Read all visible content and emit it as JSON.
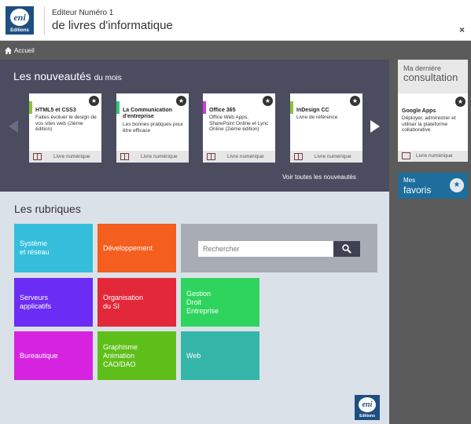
{
  "header": {
    "logo_text": "eni",
    "logo_sub": "Editions",
    "subtitle": "Editeur Numéro 1",
    "title": "de livres d'informatique",
    "close_label": "×"
  },
  "breadcrumb": {
    "home_label": "Accueil"
  },
  "releases": {
    "title_main": "Les nouveautés",
    "title_small": "du mois",
    "see_all": "Voir toutes les nouveautés",
    "books": [
      {
        "title": "HTML5 et CSS3",
        "desc": "Faites évoluer le design de vos sites web (2ième édition)",
        "type": "Livre numérique",
        "accent": "#8bc43f",
        "star": "★"
      },
      {
        "title": "La Communication d'entreprise",
        "desc": "Les bonnes pratiques pour être efficace",
        "type": "Livre numérique",
        "accent": "#2ec971",
        "star": "★"
      },
      {
        "title": "Office 365",
        "desc": "Office Web Apps, SharePoint Online et Lync Online (2ième édition)",
        "type": "Livre numérique",
        "accent": "#cc3bd4",
        "star": "★"
      },
      {
        "title": "InDesign CC",
        "desc": "Livre de référence",
        "type": "Livre numérique",
        "accent": "#8bc43f",
        "star": "★"
      }
    ]
  },
  "rubriques": {
    "title": "Les rubriques",
    "search_placeholder": "Rechercher",
    "tiles": [
      {
        "label": "Système\net réseau",
        "color": "#35bedb"
      },
      {
        "label": "Développement",
        "color": "#f45e1e"
      },
      {
        "label": "Serveurs\napplicatifs",
        "color": "#6b2cf5"
      },
      {
        "label": "Organisation\ndu SI",
        "color": "#e3283a"
      },
      {
        "label": "Gestion\nDroit\nEntreprise",
        "color": "#2ed45d"
      },
      {
        "label": "Bureautique",
        "color": "#d523e0"
      },
      {
        "label": "Graphisme\nAnimation\nCAO/DAO",
        "color": "#5fbf1a"
      },
      {
        "label": "Web",
        "color": "#36b5a9"
      }
    ]
  },
  "last_consultation": {
    "title_small": "Ma dernière",
    "title_big": "consultation",
    "book": {
      "title": "Google Apps",
      "desc": "Déployer, administrer et utiliser la plateforme collaborative",
      "type": "Livre numérique",
      "star": "★"
    }
  },
  "favoris": {
    "line1": "Mes",
    "line2": "favoris",
    "star": "★"
  }
}
